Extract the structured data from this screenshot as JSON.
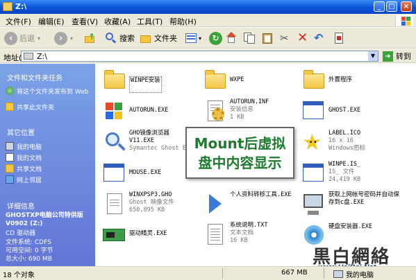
{
  "window": {
    "title": "Z:\\"
  },
  "menu": [
    "文件(F)",
    "编辑(E)",
    "查看(V)",
    "收藏(A)",
    "工具(T)",
    "帮助(H)"
  ],
  "toolbar": {
    "back_label": "后退",
    "search_label": "搜索",
    "folders_label": "文件夹"
  },
  "address": {
    "label": "地址(D)",
    "value": "Z:\\",
    "go_label": "转到"
  },
  "taskpane": {
    "file_tasks_title": "文件和文件夹任务",
    "publish_label": "将这个文件夹发布到 Web",
    "share_label": "共享此文件夹",
    "other_places_title": "其它位置",
    "places": [
      "我的电脑",
      "我的文档",
      "共享文档",
      "网上邻居"
    ],
    "details_title": "详细信息",
    "details_name": "GHOSTXP电脑公司特供版V0902 (Z:)",
    "details_type": "CD 驱动器",
    "details_fs": "文件系统: CDFS",
    "details_free": "可用空间: 0 字节",
    "details_total": "总大小: 690 MB"
  },
  "files": [
    {
      "name": "WINPE安装",
      "sub1": "",
      "sub2": "",
      "icon": "folder"
    },
    {
      "name": "WXPE",
      "sub1": "",
      "sub2": "",
      "icon": "folder"
    },
    {
      "name": "外置程序",
      "sub1": "",
      "sub2": "",
      "icon": "folder"
    },
    {
      "name": "AUTORUN.EXE",
      "sub1": "",
      "sub2": "",
      "icon": "windows-flag"
    },
    {
      "name": "AUTORUN.INF",
      "sub1": "安装信息",
      "sub2": "1 KB",
      "icon": "inf-gear"
    },
    {
      "name": "GHOST.EXE",
      "sub1": "",
      "sub2": "",
      "icon": "app-window"
    },
    {
      "name": "GHO镜像浏览器V11.EXE",
      "sub1": "Symantec Ghost E",
      "sub2": "",
      "icon": "magnifier"
    },
    {
      "name": "LABEL.ICO",
      "sub1": "16 x 16",
      "sub2": "Windows图标",
      "icon": "star"
    },
    {
      "name": "MOUSE.EXE",
      "sub1": "",
      "sub2": "",
      "icon": "app-window"
    },
    {
      "name": "WINPE.IS_",
      "sub1": "IS_ 文件",
      "sub2": "24,419 KB",
      "icon": "app-window"
    },
    {
      "name": "WINXPSP3.GHO",
      "sub1": "Ghost 映像文件",
      "sub2": "650,895 KB",
      "icon": "ghost-doc"
    },
    {
      "name": "个人资料转移工具.EXE",
      "sub1": "",
      "sub2": "",
      "icon": "blue-arrow"
    },
    {
      "name": "获取上网帐号密码并自动保存到c盘.EXE",
      "sub1": "",
      "sub2": "",
      "icon": "computer"
    },
    {
      "name": "驱动精灵.EXE",
      "sub1": "",
      "sub2": "",
      "icon": "circuit-card"
    },
    {
      "name": "系统说明.TXT",
      "sub1": "文本文档",
      "sub2": "16 KB",
      "icon": "text-doc"
    },
    {
      "name": "硬盘安装器.EXE",
      "sub1": "",
      "sub2": "",
      "icon": "disc"
    }
  ],
  "overlay": {
    "line1": "Mount后虚拟",
    "line2": "盘中内容显示"
  },
  "status": {
    "count": "18 个对象",
    "size": "667 MB",
    "location": "我的电脑"
  },
  "watermark": {
    "big": "黒白網絡",
    "url": "www.HeiBai.Net"
  }
}
